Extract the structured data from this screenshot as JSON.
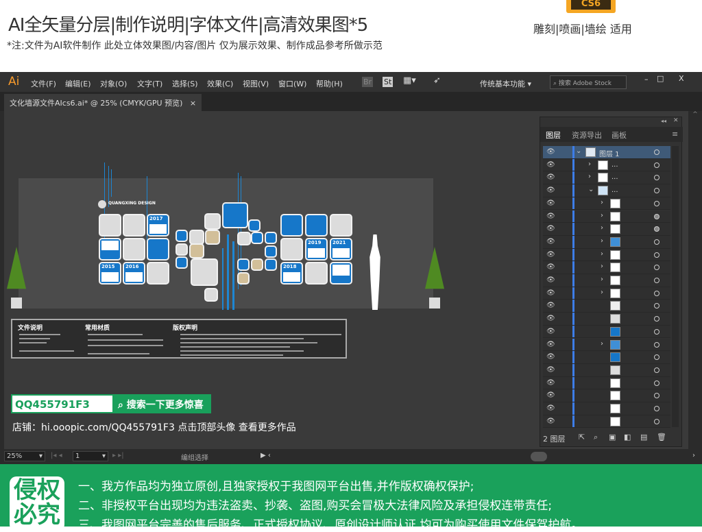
{
  "header": {
    "title": "AI全矢量分层|制作说明|字体文件|高清效果图*5",
    "subtitle": "*注:文件为AI软件制作 此处立体效果图/内容/图片 仅为展示效果、制作成品参考所做示范",
    "badge": "CS6",
    "usage": "雕刻|喷画|墙绘 适用"
  },
  "app": {
    "logo": "Ai",
    "menu": [
      "文件(F)",
      "编辑(E)",
      "对象(O)",
      "文字(T)",
      "选择(S)",
      "效果(C)",
      "视图(V)",
      "窗口(W)",
      "帮助(H)"
    ],
    "bridge": "Br",
    "stock": "St",
    "workspace": "传统基本功能",
    "search_placeholder": "搜索 Adobe Stock",
    "window_controls": [
      "–",
      "□",
      "X"
    ],
    "doc_tab": "文化墙源文件AIcs6.ai* @ 25% (CMYK/GPU 预览)",
    "doc_close": "×"
  },
  "design": {
    "brand": "QUANGXING DESIGN",
    "years": [
      "2017",
      "2015",
      "2016",
      "2019",
      "2021",
      "2018"
    ],
    "info": {
      "file": "文件说明",
      "material": "常用材质",
      "copyright": "版权声明"
    }
  },
  "promo": {
    "qq": "QQ455791F3",
    "search_btn": "搜索一下更多惊喜",
    "shop": "店铺：hi.ooopic.com/QQ455791F3  点击顶部头像 查看更多作品"
  },
  "layers": {
    "tabs": [
      "图层",
      "资源导出",
      "画板"
    ],
    "footer_count": "2 图层",
    "rows": [
      {
        "exp": "v",
        "lvl": 0,
        "label": "图层 1",
        "thumb": "#dfe8f2",
        "sel": true
      },
      {
        "exp": ">",
        "lvl": 1,
        "label": "...",
        "thumb": "#fff"
      },
      {
        "exp": ">",
        "lvl": 1,
        "label": "...",
        "thumb": "#fff"
      },
      {
        "exp": "v",
        "lvl": 1,
        "label": "...",
        "thumb": "#cfe3f5"
      },
      {
        "exp": ">",
        "lvl": 2,
        "label": "",
        "thumb": "#fff"
      },
      {
        "exp": ">",
        "lvl": 2,
        "label": "",
        "thumb": "#fff",
        "f": true
      },
      {
        "exp": ">",
        "lvl": 2,
        "label": "",
        "thumb": "#fff",
        "f": true
      },
      {
        "exp": ">",
        "lvl": 2,
        "label": "",
        "thumb": "#3f8fd6"
      },
      {
        "exp": ">",
        "lvl": 2,
        "label": "",
        "thumb": "#fff"
      },
      {
        "exp": ">",
        "lvl": 2,
        "label": "",
        "thumb": "#fff"
      },
      {
        "exp": ">",
        "lvl": 2,
        "label": "",
        "thumb": "#fff"
      },
      {
        "exp": ">",
        "lvl": 2,
        "label": "",
        "thumb": "#fff"
      },
      {
        "exp": "",
        "lvl": 2,
        "label": "",
        "thumb": "#eee"
      },
      {
        "exp": "",
        "lvl": 2,
        "label": "",
        "thumb": "#ddd"
      },
      {
        "exp": "",
        "lvl": 2,
        "label": "",
        "thumb": "#1677c9"
      },
      {
        "exp": ">",
        "lvl": 2,
        "label": "",
        "thumb": "#3f8fd6"
      },
      {
        "exp": "",
        "lvl": 2,
        "label": "",
        "thumb": "#1677c9"
      },
      {
        "exp": "",
        "lvl": 2,
        "label": "",
        "thumb": "#ddd"
      },
      {
        "exp": "",
        "lvl": 2,
        "label": "",
        "thumb": "#fff"
      },
      {
        "exp": "",
        "lvl": 2,
        "label": "",
        "thumb": "#fff"
      },
      {
        "exp": "",
        "lvl": 2,
        "label": "",
        "thumb": "#fff"
      },
      {
        "exp": "",
        "lvl": 2,
        "label": "",
        "thumb": "#fff"
      }
    ]
  },
  "status": {
    "zoom": "25%",
    "page": "1",
    "tool": "编组选择"
  },
  "notice": {
    "stamp": "侵权必究",
    "lines": [
      "一、我方作品均为独立原创,且独家授权于我图网平台出售,并作版权确权保护;",
      "二、非授权平台出现均为违法盗卖、抄袭、盗图,购买会冒极大法律风险及承担侵权连带责任;",
      "三、我图网平台完善的售后服务、正式授权协议、原创设计师认证,均可为购买使用文件保驾护航。"
    ]
  },
  "colors": {
    "accent_blue": "#1677c9",
    "green": "#1aa15b",
    "ai_orange": "#f79a2b"
  }
}
